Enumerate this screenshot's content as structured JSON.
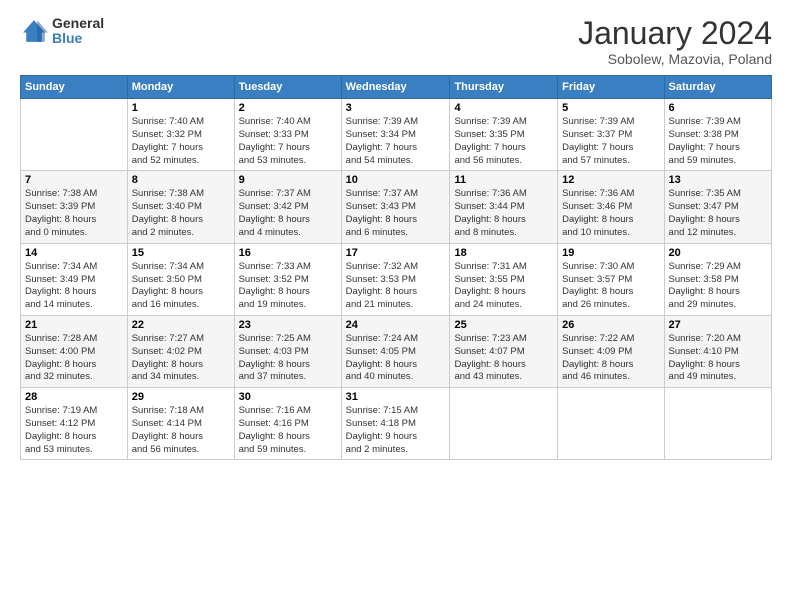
{
  "logo": {
    "line1": "General",
    "line2": "Blue"
  },
  "title": "January 2024",
  "subtitle": "Sobolew, Mazovia, Poland",
  "days_of_week": [
    "Sunday",
    "Monday",
    "Tuesday",
    "Wednesday",
    "Thursday",
    "Friday",
    "Saturday"
  ],
  "weeks": [
    [
      {
        "day": "",
        "info": ""
      },
      {
        "day": "1",
        "info": "Sunrise: 7:40 AM\nSunset: 3:32 PM\nDaylight: 7 hours\nand 52 minutes."
      },
      {
        "day": "2",
        "info": "Sunrise: 7:40 AM\nSunset: 3:33 PM\nDaylight: 7 hours\nand 53 minutes."
      },
      {
        "day": "3",
        "info": "Sunrise: 7:39 AM\nSunset: 3:34 PM\nDaylight: 7 hours\nand 54 minutes."
      },
      {
        "day": "4",
        "info": "Sunrise: 7:39 AM\nSunset: 3:35 PM\nDaylight: 7 hours\nand 56 minutes."
      },
      {
        "day": "5",
        "info": "Sunrise: 7:39 AM\nSunset: 3:37 PM\nDaylight: 7 hours\nand 57 minutes."
      },
      {
        "day": "6",
        "info": "Sunrise: 7:39 AM\nSunset: 3:38 PM\nDaylight: 7 hours\nand 59 minutes."
      }
    ],
    [
      {
        "day": "7",
        "info": "Sunrise: 7:38 AM\nSunset: 3:39 PM\nDaylight: 8 hours\nand 0 minutes."
      },
      {
        "day": "8",
        "info": "Sunrise: 7:38 AM\nSunset: 3:40 PM\nDaylight: 8 hours\nand 2 minutes."
      },
      {
        "day": "9",
        "info": "Sunrise: 7:37 AM\nSunset: 3:42 PM\nDaylight: 8 hours\nand 4 minutes."
      },
      {
        "day": "10",
        "info": "Sunrise: 7:37 AM\nSunset: 3:43 PM\nDaylight: 8 hours\nand 6 minutes."
      },
      {
        "day": "11",
        "info": "Sunrise: 7:36 AM\nSunset: 3:44 PM\nDaylight: 8 hours\nand 8 minutes."
      },
      {
        "day": "12",
        "info": "Sunrise: 7:36 AM\nSunset: 3:46 PM\nDaylight: 8 hours\nand 10 minutes."
      },
      {
        "day": "13",
        "info": "Sunrise: 7:35 AM\nSunset: 3:47 PM\nDaylight: 8 hours\nand 12 minutes."
      }
    ],
    [
      {
        "day": "14",
        "info": "Sunrise: 7:34 AM\nSunset: 3:49 PM\nDaylight: 8 hours\nand 14 minutes."
      },
      {
        "day": "15",
        "info": "Sunrise: 7:34 AM\nSunset: 3:50 PM\nDaylight: 8 hours\nand 16 minutes."
      },
      {
        "day": "16",
        "info": "Sunrise: 7:33 AM\nSunset: 3:52 PM\nDaylight: 8 hours\nand 19 minutes."
      },
      {
        "day": "17",
        "info": "Sunrise: 7:32 AM\nSunset: 3:53 PM\nDaylight: 8 hours\nand 21 minutes."
      },
      {
        "day": "18",
        "info": "Sunrise: 7:31 AM\nSunset: 3:55 PM\nDaylight: 8 hours\nand 24 minutes."
      },
      {
        "day": "19",
        "info": "Sunrise: 7:30 AM\nSunset: 3:57 PM\nDaylight: 8 hours\nand 26 minutes."
      },
      {
        "day": "20",
        "info": "Sunrise: 7:29 AM\nSunset: 3:58 PM\nDaylight: 8 hours\nand 29 minutes."
      }
    ],
    [
      {
        "day": "21",
        "info": "Sunrise: 7:28 AM\nSunset: 4:00 PM\nDaylight: 8 hours\nand 32 minutes."
      },
      {
        "day": "22",
        "info": "Sunrise: 7:27 AM\nSunset: 4:02 PM\nDaylight: 8 hours\nand 34 minutes."
      },
      {
        "day": "23",
        "info": "Sunrise: 7:25 AM\nSunset: 4:03 PM\nDaylight: 8 hours\nand 37 minutes."
      },
      {
        "day": "24",
        "info": "Sunrise: 7:24 AM\nSunset: 4:05 PM\nDaylight: 8 hours\nand 40 minutes."
      },
      {
        "day": "25",
        "info": "Sunrise: 7:23 AM\nSunset: 4:07 PM\nDaylight: 8 hours\nand 43 minutes."
      },
      {
        "day": "26",
        "info": "Sunrise: 7:22 AM\nSunset: 4:09 PM\nDaylight: 8 hours\nand 46 minutes."
      },
      {
        "day": "27",
        "info": "Sunrise: 7:20 AM\nSunset: 4:10 PM\nDaylight: 8 hours\nand 49 minutes."
      }
    ],
    [
      {
        "day": "28",
        "info": "Sunrise: 7:19 AM\nSunset: 4:12 PM\nDaylight: 8 hours\nand 53 minutes."
      },
      {
        "day": "29",
        "info": "Sunrise: 7:18 AM\nSunset: 4:14 PM\nDaylight: 8 hours\nand 56 minutes."
      },
      {
        "day": "30",
        "info": "Sunrise: 7:16 AM\nSunset: 4:16 PM\nDaylight: 8 hours\nand 59 minutes."
      },
      {
        "day": "31",
        "info": "Sunrise: 7:15 AM\nSunset: 4:18 PM\nDaylight: 9 hours\nand 2 minutes."
      },
      {
        "day": "",
        "info": ""
      },
      {
        "day": "",
        "info": ""
      },
      {
        "day": "",
        "info": ""
      }
    ]
  ]
}
